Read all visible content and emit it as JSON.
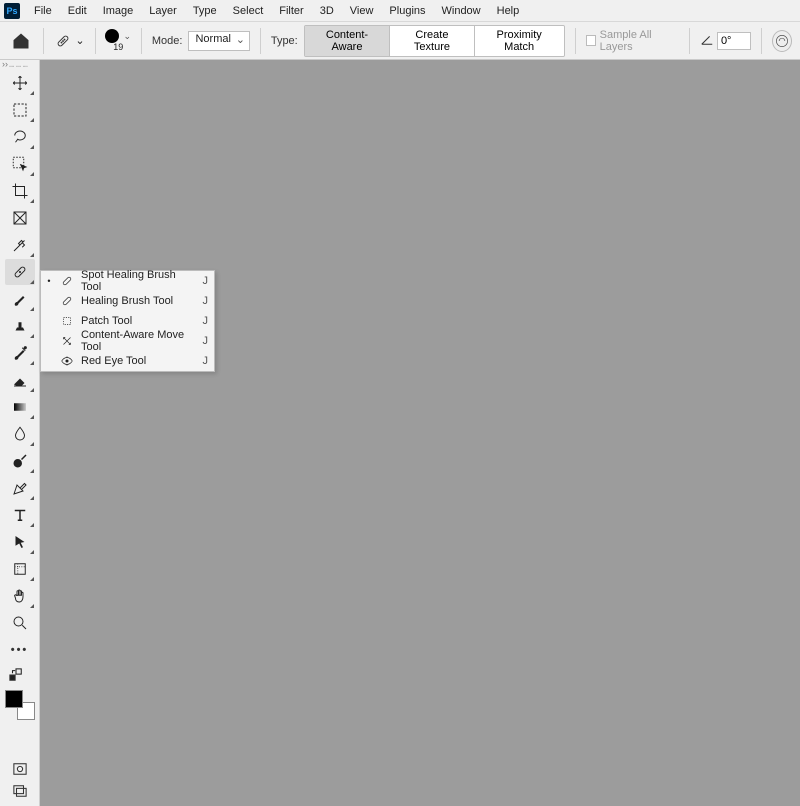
{
  "app_icon_text": "Ps",
  "menubar": [
    "File",
    "Edit",
    "Image",
    "Layer",
    "Type",
    "Select",
    "Filter",
    "3D",
    "View",
    "Plugins",
    "Window",
    "Help"
  ],
  "options": {
    "brush_size": "19",
    "mode_label": "Mode:",
    "mode_value": "Normal",
    "type_label": "Type:",
    "seg": [
      "Content-Aware",
      "Create Texture",
      "Proximity Match"
    ],
    "seg_active": 0,
    "sample_all_label": "Sample All Layers",
    "angle_value": "0°"
  },
  "tools": [
    {
      "name": "move-tool"
    },
    {
      "name": "marquee-tool"
    },
    {
      "name": "lasso-tool"
    },
    {
      "name": "object-selection-tool"
    },
    {
      "name": "crop-tool"
    },
    {
      "name": "frame-tool"
    },
    {
      "name": "eyedropper-tool"
    },
    {
      "name": "spot-healing-brush-tool",
      "active": true
    },
    {
      "name": "brush-tool"
    },
    {
      "name": "clone-stamp-tool"
    },
    {
      "name": "history-brush-tool"
    },
    {
      "name": "eraser-tool"
    },
    {
      "name": "gradient-tool"
    },
    {
      "name": "blur-tool"
    },
    {
      "name": "dodge-tool"
    },
    {
      "name": "pen-tool"
    },
    {
      "name": "type-tool"
    },
    {
      "name": "path-selection-tool"
    },
    {
      "name": "shape-tool"
    },
    {
      "name": "hand-tool"
    },
    {
      "name": "zoom-tool"
    }
  ],
  "flyout": [
    {
      "label": "Spot Healing Brush Tool",
      "shortcut": "J",
      "active": true,
      "icon": "bandage"
    },
    {
      "label": "Healing Brush Tool",
      "shortcut": "J",
      "icon": "bandage"
    },
    {
      "label": "Patch Tool",
      "shortcut": "J",
      "icon": "patch"
    },
    {
      "label": "Content-Aware Move Tool",
      "shortcut": "J",
      "icon": "move-arrows"
    },
    {
      "label": "Red Eye Tool",
      "shortcut": "J",
      "icon": "eye"
    }
  ]
}
